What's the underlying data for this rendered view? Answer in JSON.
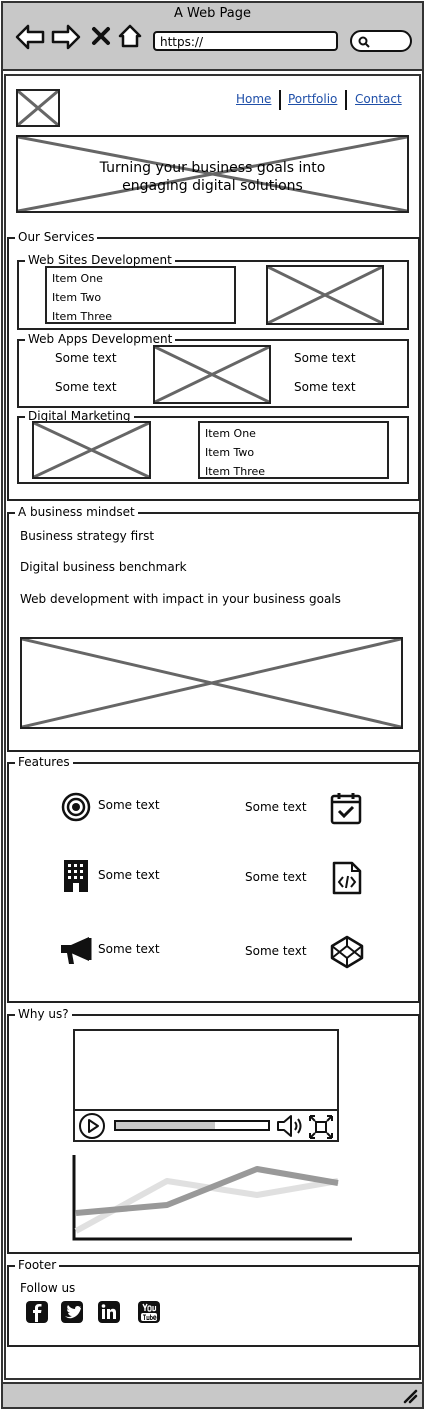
{
  "browser": {
    "title": "A Web Page",
    "url": "https://"
  },
  "nav": {
    "items": [
      "Home",
      "Portfolio",
      "Contact"
    ]
  },
  "hero": {
    "line1": "Turning your business goals into",
    "line2": "engaging digital solutions"
  },
  "services": {
    "title": "Our Services",
    "web_sites": {
      "title": "Web Sites Development",
      "items": [
        "Item One",
        "Item Two",
        "Item Three"
      ]
    },
    "web_apps": {
      "title": "Web Apps Development",
      "texts": [
        "Some text",
        "Some text",
        "Some text",
        "Some text"
      ]
    },
    "marketing": {
      "title": "Digital Marketing",
      "items": [
        "Item One",
        "Item Two",
        "Item Three"
      ]
    }
  },
  "mindset": {
    "title": "A business mindset",
    "lines": [
      "Business strategy first",
      "Digital business benchmark",
      "Web development with impact in your business goals"
    ]
  },
  "features": {
    "title": "Features",
    "items": [
      {
        "label": "Some text",
        "icon": "target-icon"
      },
      {
        "label": "Some text",
        "icon": "calendar-check-icon"
      },
      {
        "label": "Some text",
        "icon": "building-icon"
      },
      {
        "label": "Some text",
        "icon": "code-file-icon"
      },
      {
        "label": "Some text",
        "icon": "megaphone-icon"
      },
      {
        "label": "Some text",
        "icon": "codepen-icon"
      }
    ]
  },
  "why": {
    "title": "Why us?",
    "video_progress": 0.65
  },
  "footer": {
    "title": "Footer",
    "follow": "Follow us",
    "social": [
      "facebook-icon",
      "twitter-icon",
      "linkedin-icon",
      "youtube-icon"
    ]
  },
  "colors": {
    "nav_link": "#1f4fa8",
    "chrome": "#c8c8c8",
    "line_dark": "#999999",
    "line_light": "#e0e0e0"
  }
}
